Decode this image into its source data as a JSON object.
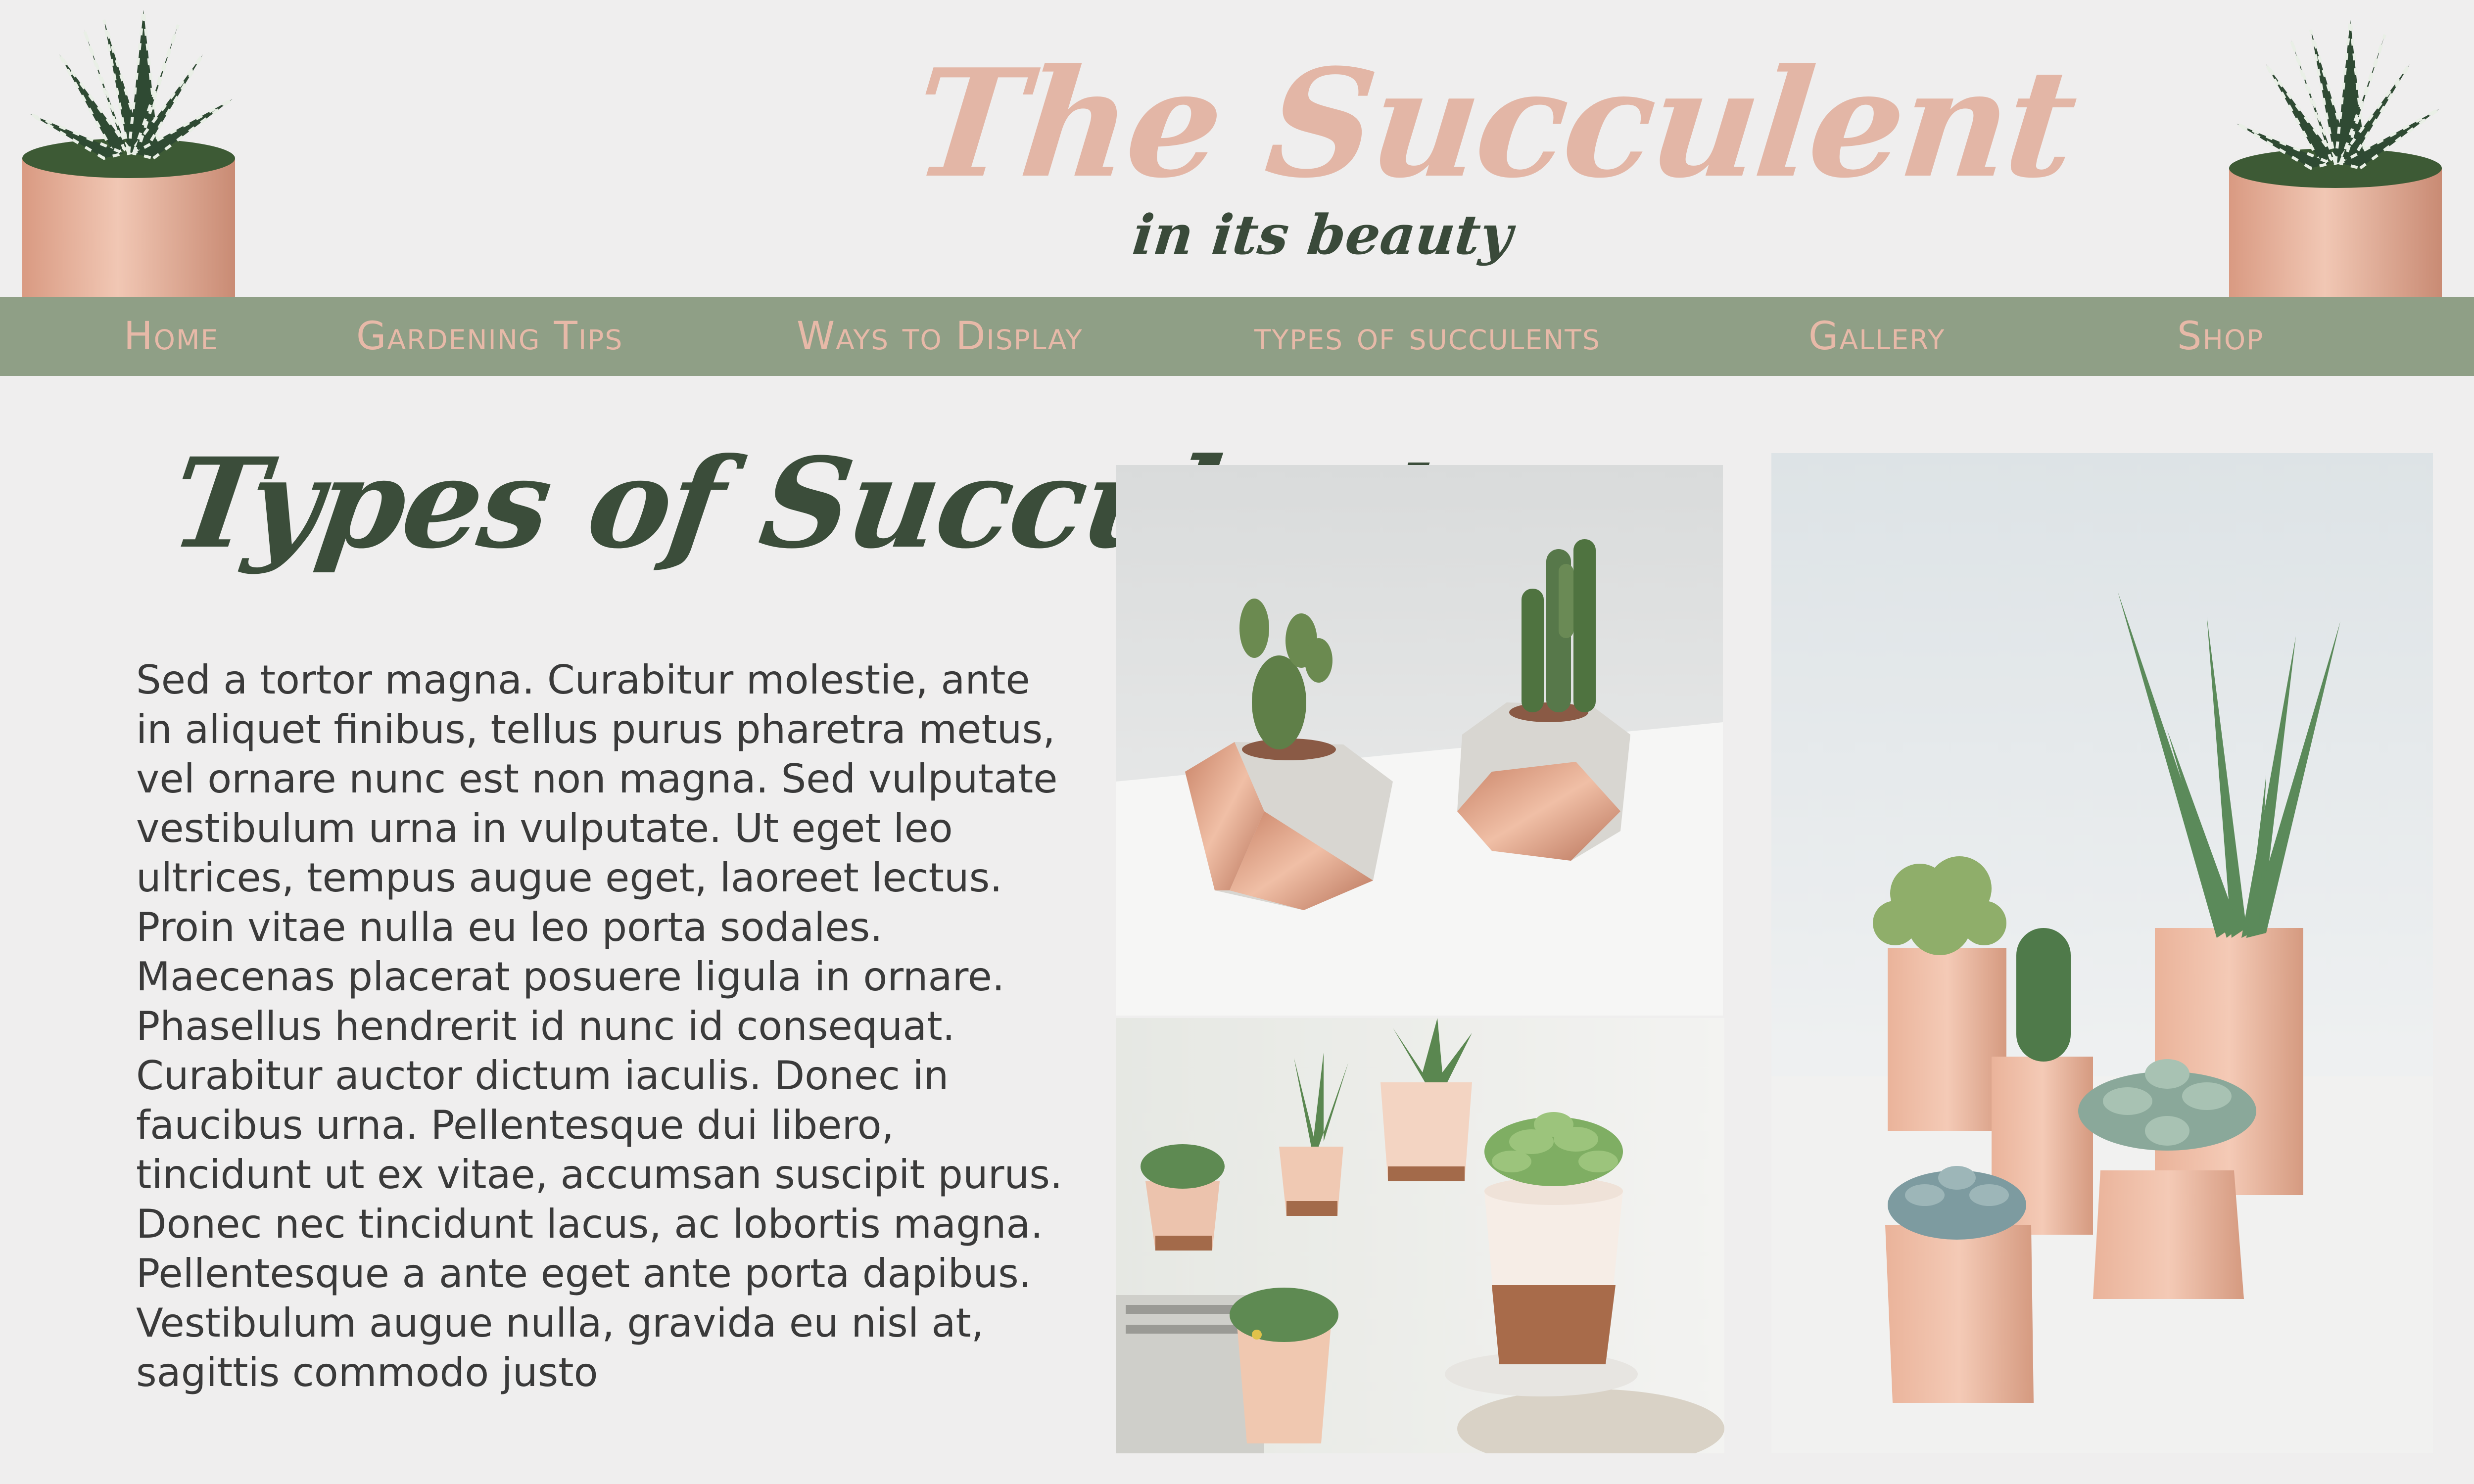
{
  "header": {
    "logo_title": "The Succulent",
    "logo_tagline": "in its beauty"
  },
  "nav": {
    "items": [
      {
        "label": "Home"
      },
      {
        "label": "Gardening Tips"
      },
      {
        "label": "Ways to Display"
      },
      {
        "label": "types of succulents"
      },
      {
        "label": "Gallery"
      },
      {
        "label": "Shop"
      }
    ]
  },
  "main": {
    "title": "Types of Succulents",
    "body": "Sed a tortor magna. Curabitur molestie, ante in aliquet finibus, tellus purus pharetra metus, vel ornare nunc est non magna. Sed vulputate vestibulum urna in vulputate. Ut eget leo ultrices, tempus augue eget, laoreet lectus. Proin vitae nulla eu leo porta sodales. Maecenas placerat posuere ligula in ornare. Phasellus hendrerit id nunc id consequat. Curabitur auctor dictum iaculis. Donec in faucibus urna. Pellentesque dui libero, tincidunt ut ex vitae, accumsan suscipit purus. Donec nec tincidunt lacus, ac lobortis magna. Pellentesque a ante eget ante porta dapibus. Vestibulum augue nulla, gravida eu nisl at, sagittis commodo justo"
  },
  "colors": {
    "background": "#efeeee",
    "nav_background": "#8f9f86",
    "nav_text": "#e7b9a8",
    "logo_pink": "#e3b6a6",
    "dark_green": "#3b4d3a",
    "body_text": "#3a3a3a"
  },
  "icons": {
    "corner_plant_left": "potted-zebra-succulent-icon",
    "corner_plant_right": "potted-zebra-succulent-icon"
  }
}
